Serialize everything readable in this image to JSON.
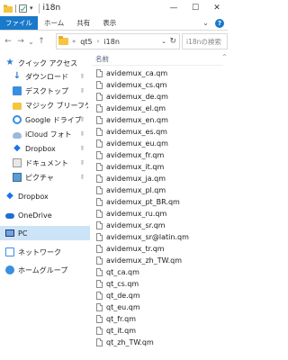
{
  "window": {
    "title": "i18n",
    "minimize_glyph": "—",
    "maximize_glyph": "☐",
    "close_glyph": "✕"
  },
  "ribbon": {
    "tabs": [
      "ファイル",
      "ホーム",
      "共有",
      "表示"
    ],
    "file_tab_color": "#1979ca"
  },
  "address": {
    "back": "←",
    "forward": "→",
    "recent": "⌄",
    "up": "↑",
    "overflow": "«",
    "crumbs": [
      "qt5",
      "i18n"
    ],
    "crumb_sep": "›",
    "search_placeholder": "i18nの検索"
  },
  "nav": {
    "items": [
      {
        "label": "クイック アクセス",
        "icon": "star-icon",
        "pinned": false
      },
      {
        "label": "ダウンロード",
        "icon": "download-icon",
        "pinned": true
      },
      {
        "label": "デスクトップ",
        "icon": "desktop-icon",
        "pinned": true
      },
      {
        "label": "マジック ブリーフケース",
        "icon": "folder-icon",
        "pinned": true
      },
      {
        "label": "Google ドライブ",
        "icon": "google-drive-icon",
        "pinned": true
      },
      {
        "label": "iCloud フォト",
        "icon": "icloud-icon",
        "pinned": true
      },
      {
        "label": "Dropbox",
        "icon": "dropbox-icon",
        "pinned": true
      },
      {
        "label": "ドキュメント",
        "icon": "documents-icon",
        "pinned": true
      },
      {
        "label": "ピクチャ",
        "icon": "pictures-icon",
        "pinned": true
      },
      {
        "label": "Dropbox",
        "icon": "dropbox-icon",
        "pinned": false
      },
      {
        "label": "OneDrive",
        "icon": "onedrive-icon",
        "pinned": false
      },
      {
        "label": "PC",
        "icon": "pc-icon",
        "pinned": false,
        "selected": true
      },
      {
        "label": "ネットワーク",
        "icon": "network-icon",
        "pinned": false
      },
      {
        "label": "ホームグループ",
        "icon": "homegroup-icon",
        "pinned": false
      }
    ]
  },
  "files": {
    "column_header": "名前",
    "items": [
      "avidemux_ca.qm",
      "avidemux_cs.qm",
      "avidemux_de.qm",
      "avidemux_el.qm",
      "avidemux_en.qm",
      "avidemux_es.qm",
      "avidemux_eu.qm",
      "avidemux_fr.qm",
      "avidemux_it.qm",
      "avidemux_ja.qm",
      "avidemux_pl.qm",
      "avidemux_pt_BR.qm",
      "avidemux_ru.qm",
      "avidemux_sr.qm",
      "avidemux_sr@latin.qm",
      "avidemux_tr.qm",
      "avidemux_zh_TW.qm",
      "qt_ca.qm",
      "qt_cs.qm",
      "qt_de.qm",
      "qt_eu.qm",
      "qt_fr.qm",
      "qt_it.qm",
      "qt_zh_TW.qm"
    ]
  }
}
